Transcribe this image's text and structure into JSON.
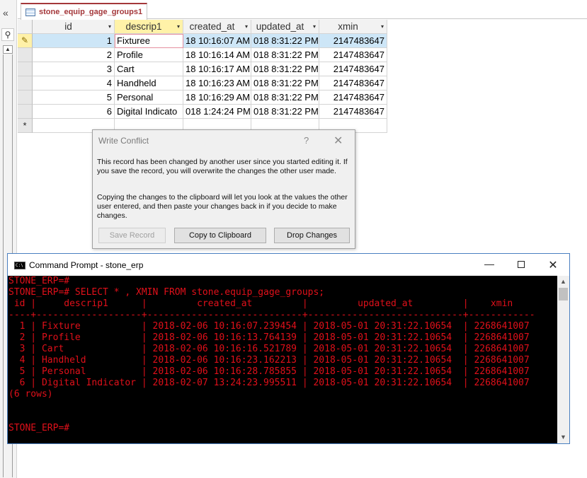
{
  "nav": {
    "collapse_glyph": "«",
    "search_icon": "search-icon"
  },
  "tab": {
    "label": "stone_equip_gage_groups1"
  },
  "datasheet": {
    "columns": [
      {
        "label": "id",
        "sort_glyph": "▾"
      },
      {
        "label": "descrip1",
        "sort_glyph": "▾"
      },
      {
        "label": "created_at",
        "sort_glyph": "▾"
      },
      {
        "label": "updated_at",
        "sort_glyph": "▾"
      },
      {
        "label": "xmin",
        "sort_glyph": "▾"
      }
    ],
    "rows": [
      {
        "selector": "✎",
        "id": "1",
        "descrip1": "Fixturee",
        "created_at": "18 10:16:07 AM",
        "updated_at": "018 8:31:22 PM",
        "xmin": "2147483647"
      },
      {
        "selector": "",
        "id": "2",
        "descrip1": "Profile",
        "created_at": "18 10:16:14 AM",
        "updated_at": "018 8:31:22 PM",
        "xmin": "2147483647"
      },
      {
        "selector": "",
        "id": "3",
        "descrip1": "Cart",
        "created_at": "18 10:16:17 AM",
        "updated_at": "018 8:31:22 PM",
        "xmin": "2147483647"
      },
      {
        "selector": "",
        "id": "4",
        "descrip1": "Handheld",
        "created_at": "18 10:16:23 AM",
        "updated_at": "018 8:31:22 PM",
        "xmin": "2147483647"
      },
      {
        "selector": "",
        "id": "5",
        "descrip1": "Personal",
        "created_at": "18 10:16:29 AM",
        "updated_at": "018 8:31:22 PM",
        "xmin": "2147483647"
      },
      {
        "selector": "",
        "id": "6",
        "descrip1": "Digital Indicato",
        "created_at": "018 1:24:24 PM",
        "updated_at": "018 8:31:22 PM",
        "xmin": "2147483647"
      }
    ],
    "new_row_selector": "*"
  },
  "dialog": {
    "title": "Write Conflict",
    "help_glyph": "?",
    "close_glyph": "✕",
    "message1": "This record has been changed by another user since you started editing it.  If you save the record, you will overwrite the changes the other user made.",
    "message2": "Copying the changes to the clipboard will let you look at the values the other user entered, and then paste your changes back in if you decide to make changes.",
    "save_label": "Save Record",
    "copy_label": "Copy to Clipboard",
    "drop_label": "Drop Changes"
  },
  "cmd": {
    "icon_text": "C:\\",
    "title": "Command Prompt - stone_erp",
    "minimize_glyph": "—",
    "close_glyph": "✕",
    "lines": [
      "STONE_ERP=#",
      "STONE_ERP=# SELECT * , XMIN FROM stone.equip_gage_groups;",
      " id |     descrip1      |         created_at         |         updated_at         |    xmin",
      "----+-------------------+----------------------------+----------------------------+------------",
      "  1 | Fixture           | 2018-02-06 10:16:07.239454 | 2018-05-01 20:31:22.10654  | 2268641007",
      "  2 | Profile           | 2018-02-06 10:16:13.764139 | 2018-05-01 20:31:22.10654  | 2268641007",
      "  3 | Cart              | 2018-02-06 10:16:16.521789 | 2018-05-01 20:31:22.10654  | 2268641007",
      "  4 | Handheld          | 2018-02-06 10:16:23.162213 | 2018-05-01 20:31:22.10654  | 2268641007",
      "  5 | Personal          | 2018-02-06 10:16:28.785855 | 2018-05-01 20:31:22.10654  | 2268641007",
      "  6 | Digital Indicator | 2018-02-07 13:24:23.995511 | 2018-05-01 20:31:22.10654  | 2268641007",
      "(6 rows)",
      "",
      "",
      "STONE_ERP=#"
    ],
    "text_color": "#e0101a"
  }
}
